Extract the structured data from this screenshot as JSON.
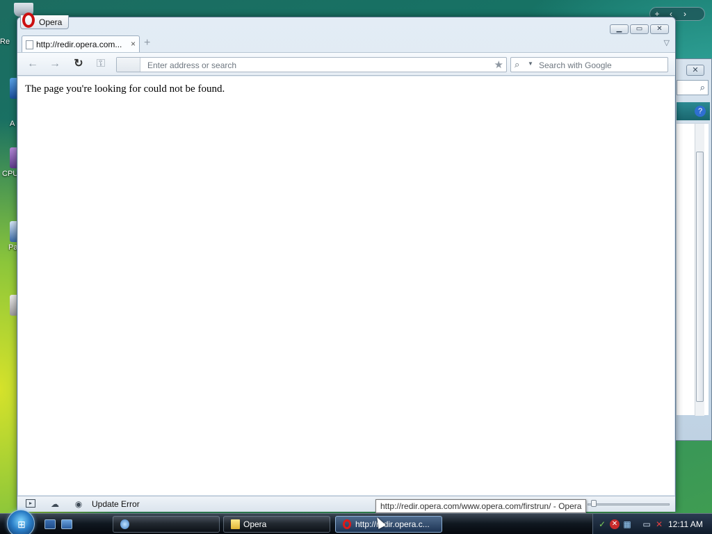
{
  "desktop": {
    "icons": [
      {
        "label": "Re"
      },
      {
        "label": "A"
      },
      {
        "label": "CPU"
      },
      {
        "label": "Pa"
      }
    ],
    "gadget_controls": [
      "+",
      "‹",
      "›"
    ]
  },
  "background_window": {
    "close_glyph": "✕",
    "help_glyph": "?"
  },
  "opera": {
    "menu_label": "Opera",
    "window_buttons": {
      "minimize": "▁",
      "maximize": "▭",
      "close": "✕"
    },
    "tabs": [
      {
        "title": "http://redir.opera.com...",
        "close": "×"
      }
    ],
    "new_tab_glyph": "+",
    "address_placeholder": "Enter address or search",
    "search_placeholder": "Search with Google",
    "page_message": "The page you're looking for could not be found.",
    "status_text": "Update Error",
    "tooltip": "http://redir.opera.com/www.opera.com/firstrun/ - Opera"
  },
  "taskbar": {
    "tasks": [
      {
        "label": "",
        "icon": "network-icon",
        "active": false
      },
      {
        "label": "Opera",
        "icon": "folder-icon",
        "active": false
      },
      {
        "label": "http://redir.opera.c...",
        "icon": "opera-icon",
        "active": true
      }
    ],
    "clock": "12:11 AM"
  },
  "colors": {
    "opera_red": "#cc1010",
    "window_frame": "#d4e0ec",
    "taskbar": "#101820"
  }
}
